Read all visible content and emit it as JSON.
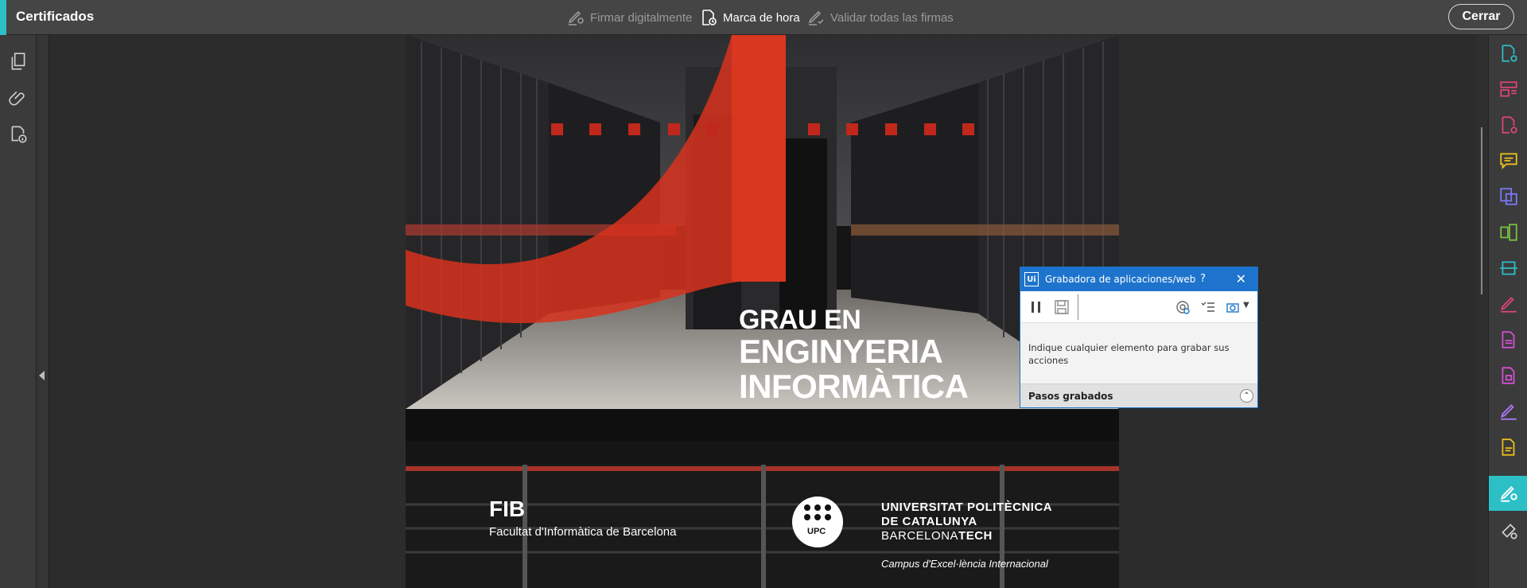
{
  "topbar": {
    "title": "Certificados",
    "sign_label": "Firmar digitalmente",
    "timestamp_label": "Marca de hora",
    "validate_label": "Validar todas las firmas",
    "close_label": "Cerrar",
    "accent_color": "#2dbfc6"
  },
  "left_rail": {
    "icons": [
      "pages-icon",
      "attachment-icon",
      "certificate-info-icon"
    ]
  },
  "right_rail": {
    "icons": [
      "create-pdf-icon",
      "organize-pages-icon",
      "add-pdf-icon",
      "comment-icon",
      "export-pdf-icon",
      "compare-icon",
      "scan-icon",
      "fill-sign-icon",
      "edit-pdf-icon",
      "protect-icon",
      "request-signature-icon",
      "certificates-icon",
      "more-tools-icon"
    ],
    "active": "certificates-icon"
  },
  "document": {
    "line1": "GRAU EN",
    "line2": "ENGINYERIA",
    "line3": "INFORMÀTICA",
    "fib": "FIB",
    "fib_name": "Facultat d'Informàtica de Barcelona",
    "upc_badge": "UPC",
    "upc_line1": "UNIVERSITAT POLITÈCNICA",
    "upc_line2": "DE CATALUNYA",
    "upc_line3a": "BARCELONA",
    "upc_line3b": "TECH",
    "campus": "Campus d'Excel·lència Internacional"
  },
  "recorder": {
    "logo": "Ui",
    "title": "Grabadora de aplicaciones/web",
    "help": "?",
    "close": "✕",
    "message": "Indique cualquier elemento para grabar sus acciones",
    "footer": "Pasos grabados",
    "caret": "⌃"
  }
}
